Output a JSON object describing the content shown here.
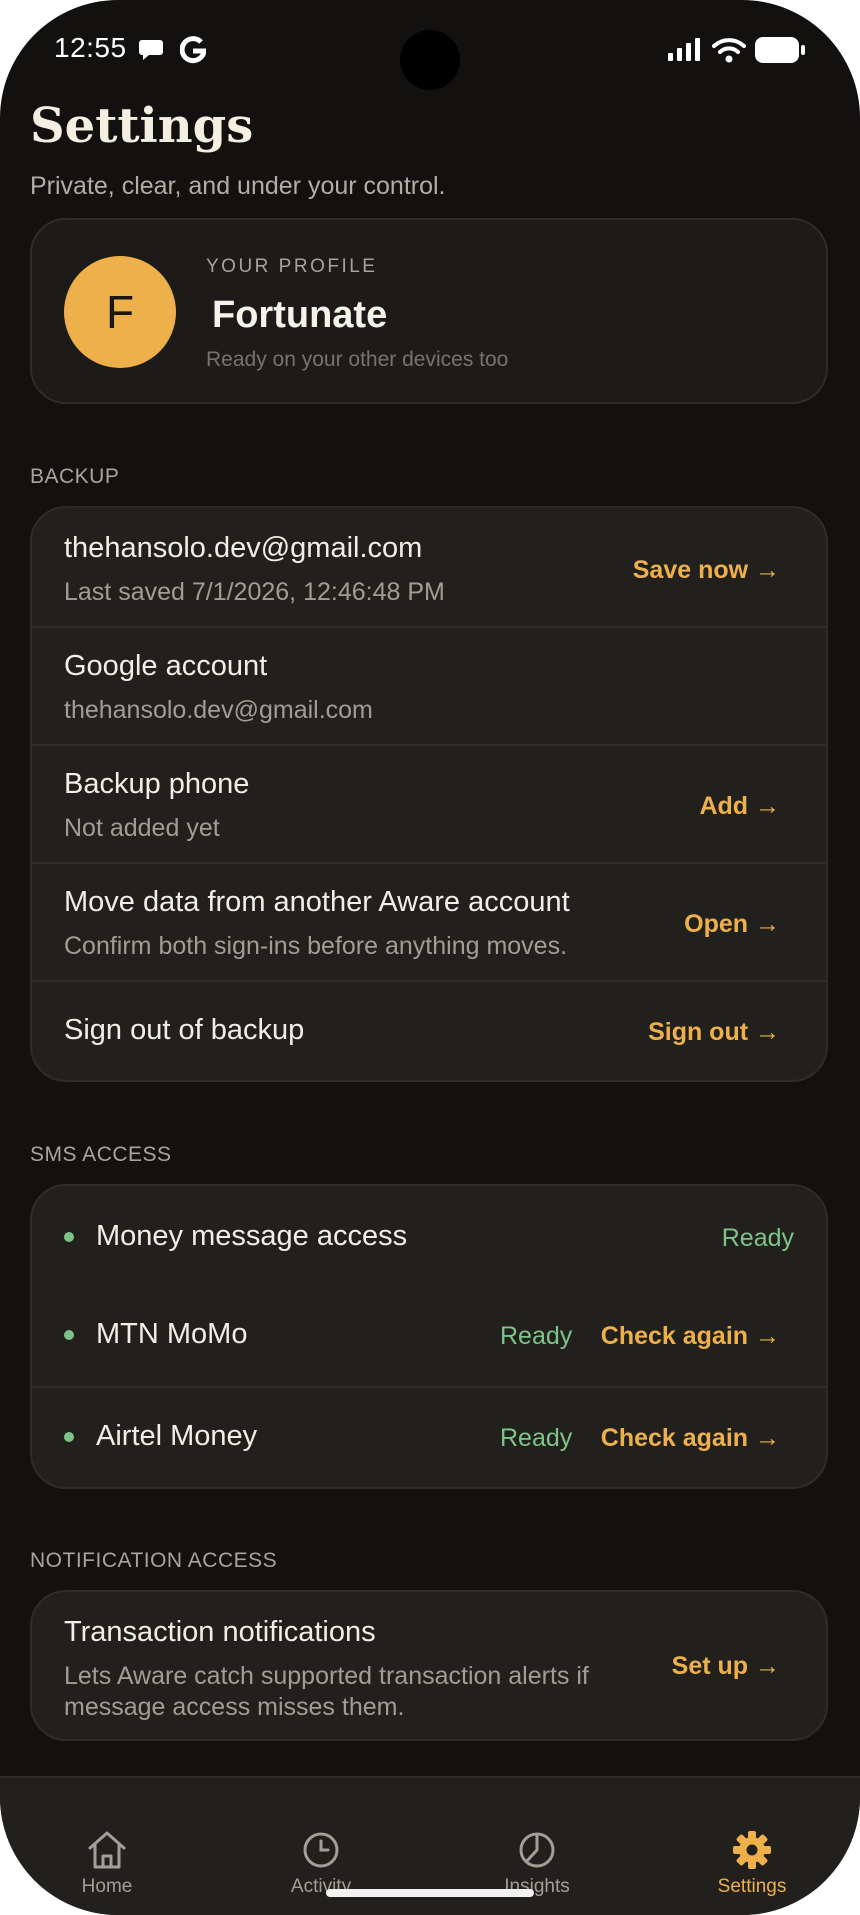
{
  "status_bar": {
    "time": "12:55"
  },
  "header": {
    "title": "Settings",
    "subtitle": "Private, clear, and under your control."
  },
  "profile": {
    "initial": "F",
    "label": "YOUR PROFILE",
    "name": "Fortunate",
    "subtitle": "Ready on your other devices too"
  },
  "backup": {
    "section_label": "BACKUP",
    "rows": [
      {
        "title": "thehansolo.dev@gmail.com",
        "subtitle": "Last saved 7/1/2026, 12:46:48 PM",
        "action": "Save now →"
      },
      {
        "title": "Google account",
        "subtitle": "thehansolo.dev@gmail.com"
      },
      {
        "title": "Backup phone",
        "subtitle": "Not added yet",
        "action": "Add →"
      },
      {
        "title": "Move data from another Aware account",
        "subtitle": "Confirm both sign-ins before anything moves.",
        "action": "Open →"
      },
      {
        "title": "Sign out of backup",
        "action": "Sign out →"
      }
    ]
  },
  "sms_access": {
    "section_label": "SMS ACCESS",
    "rows": [
      {
        "title": "Money message access",
        "status": "Ready"
      },
      {
        "title": "MTN MoMo",
        "status": "Ready",
        "action": "Check again →"
      },
      {
        "title": "Airtel Money",
        "status": "Ready",
        "action": "Check again →"
      }
    ]
  },
  "notification_access": {
    "section_label": "NOTIFICATION ACCESS",
    "row": {
      "title": "Transaction notifications",
      "subtitle_line1": "Lets Aware catch supported transaction alerts if",
      "subtitle_line2": "message access misses them.",
      "action": "Set up →"
    }
  },
  "nav": {
    "items": [
      {
        "label": "Home",
        "icon": "home-icon"
      },
      {
        "label": "Activity",
        "icon": "clock-icon"
      },
      {
        "label": "Insights",
        "icon": "pie-chart-icon"
      },
      {
        "label": "Settings",
        "icon": "gear-icon",
        "active": true
      }
    ]
  },
  "colors": {
    "background": "#121110",
    "card": "#22201d",
    "accent": "#eeb04b",
    "ready": "#7ec489"
  }
}
